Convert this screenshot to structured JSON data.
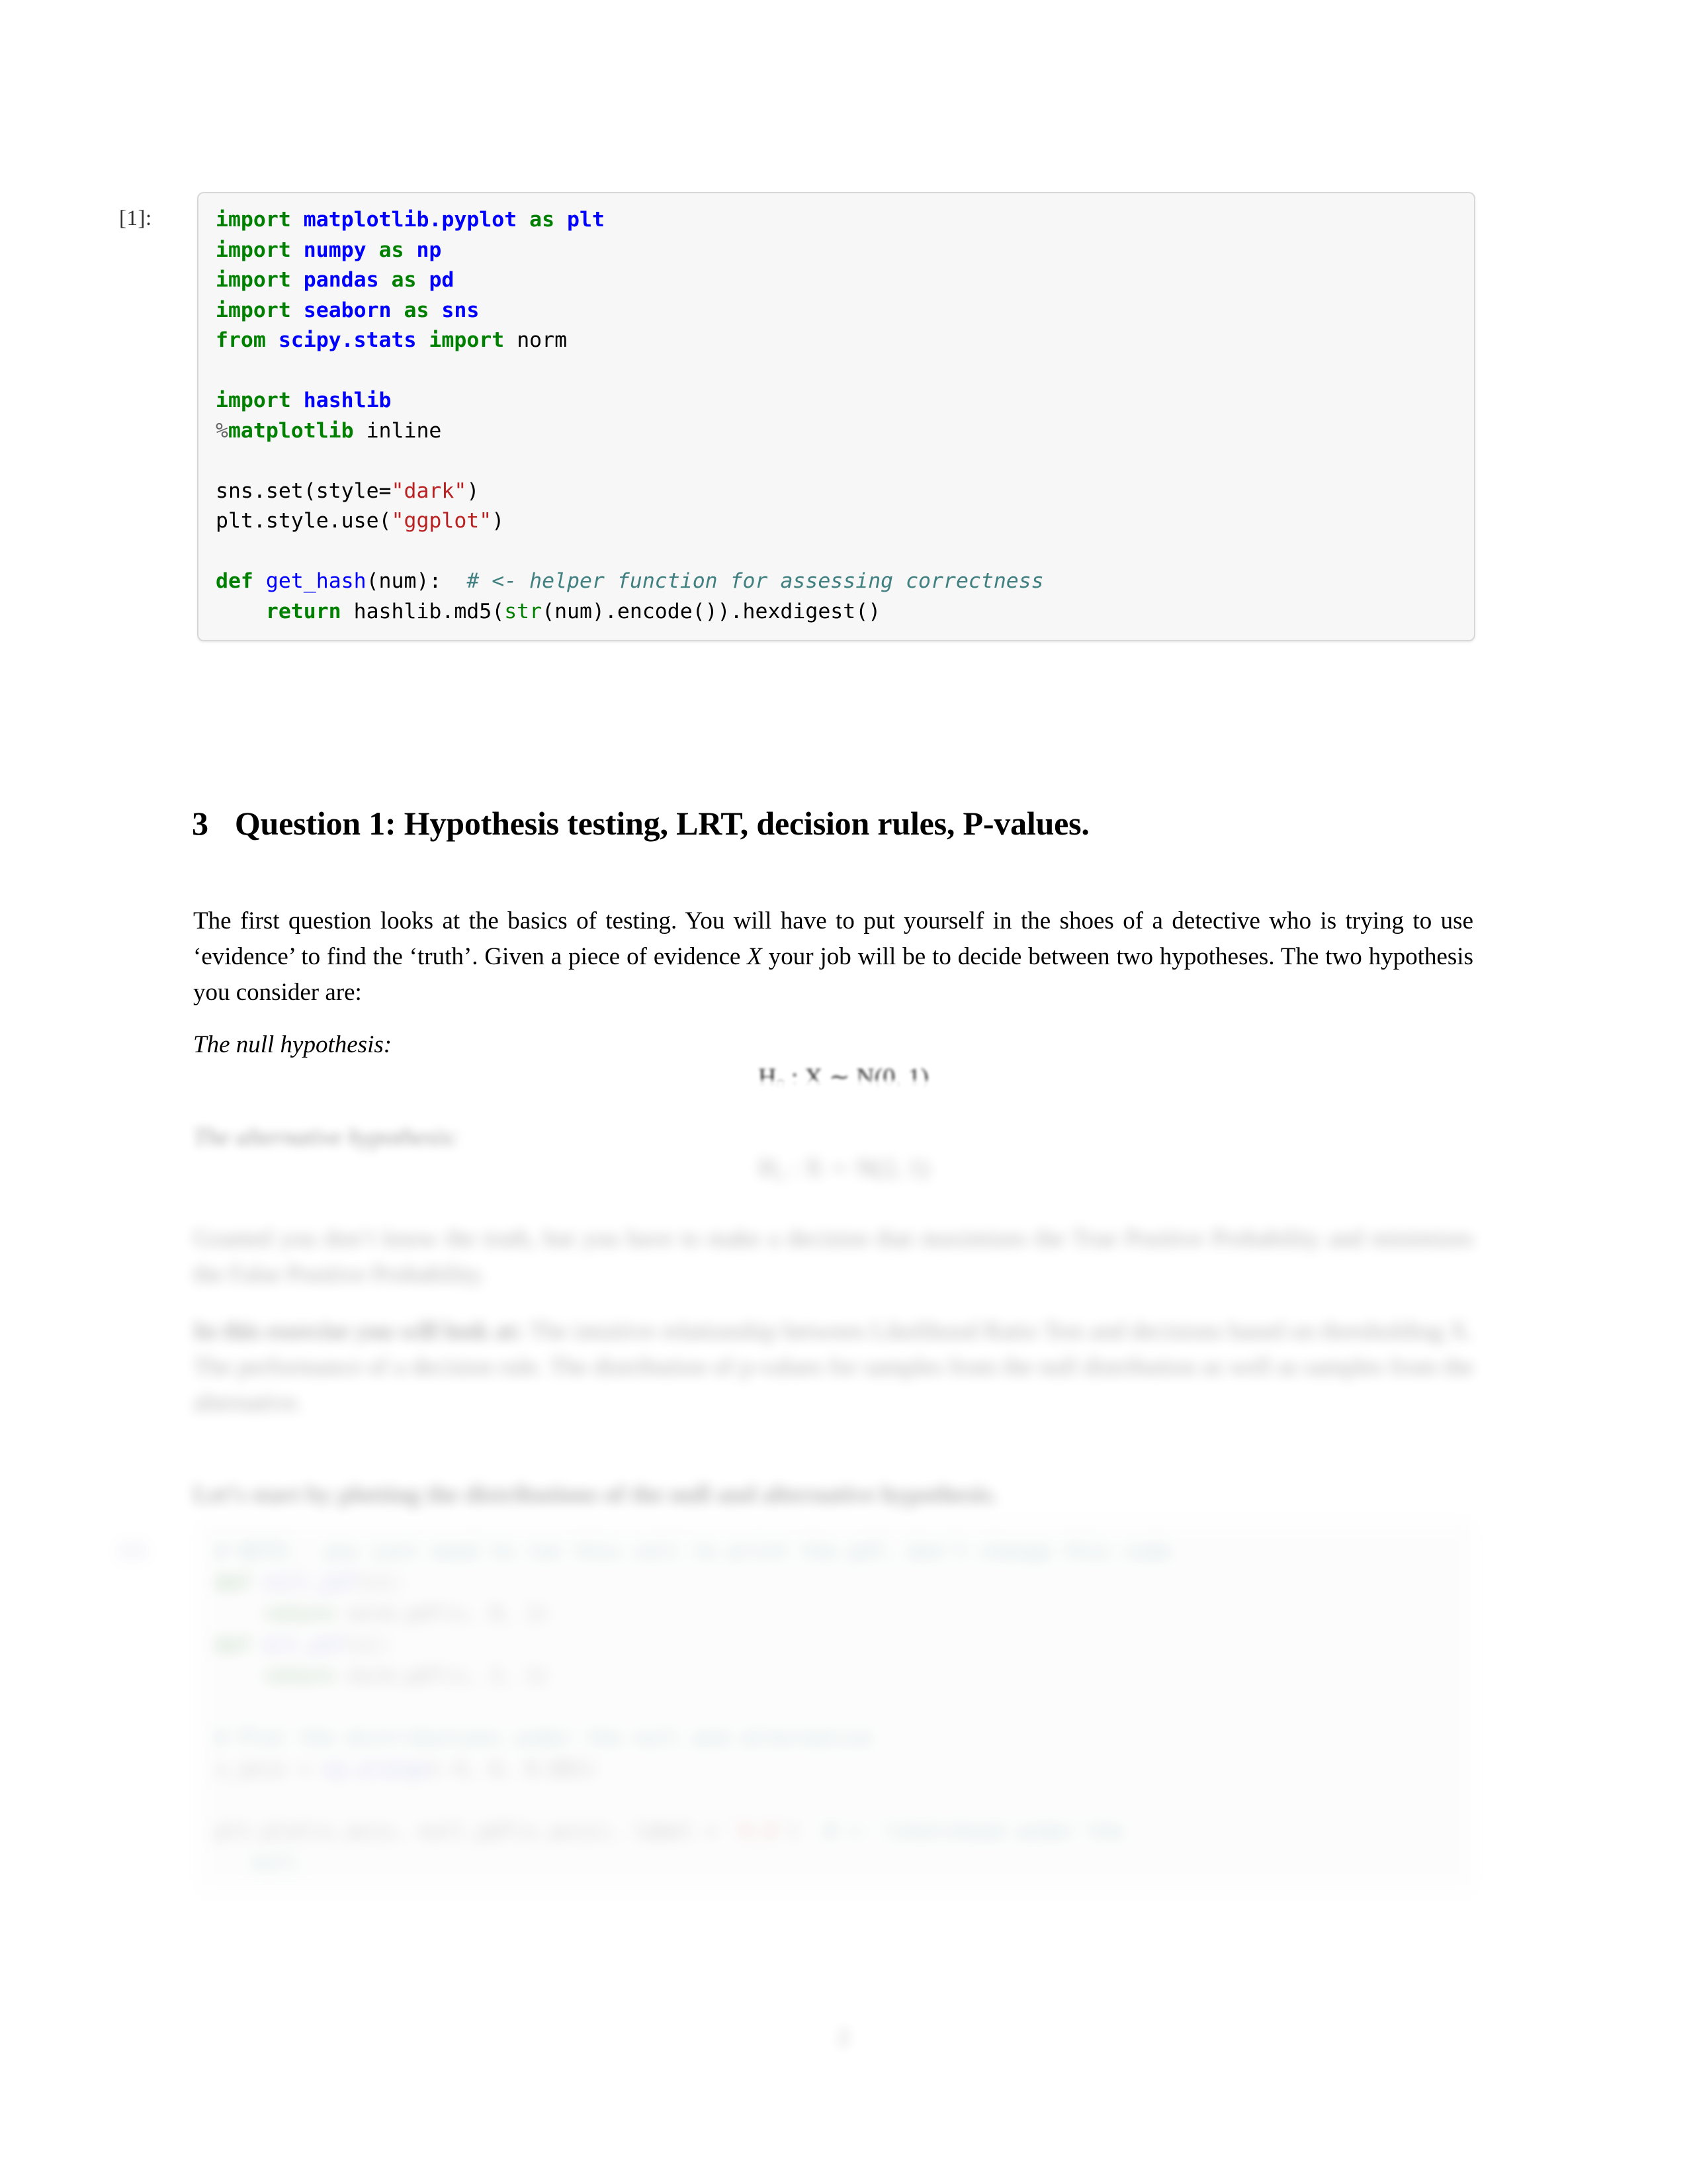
{
  "document": {
    "kind": "jupyter-notebook-pdf",
    "page_number": "2"
  },
  "code_cell_1": {
    "prompt": "[1]:",
    "lines": [
      {
        "id": "l1",
        "text": "import matplotlib.pyplot as plt"
      },
      {
        "id": "l2",
        "text": "import numpy as np"
      },
      {
        "id": "l3",
        "text": "import pandas as pd"
      },
      {
        "id": "l4",
        "text": "import seaborn as sns"
      },
      {
        "id": "l5",
        "text": "from scipy.stats import norm"
      },
      {
        "id": "l6",
        "text": ""
      },
      {
        "id": "l7",
        "text": "import hashlib"
      },
      {
        "id": "l8",
        "text": "%matplotlib inline"
      },
      {
        "id": "l9",
        "text": ""
      },
      {
        "id": "l10",
        "text": "sns.set(style=\"dark\")"
      },
      {
        "id": "l11",
        "text": "plt.style.use(\"ggplot\")"
      },
      {
        "id": "l12",
        "text": ""
      },
      {
        "id": "l13",
        "text": "def get_hash(num):  # <- helper function for assessing correctness"
      },
      {
        "id": "l14",
        "text": "    return hashlib.md5(str(num).encode()).hexdigest()"
      }
    ],
    "tokens": {
      "import": "import",
      "from": "from",
      "def": "def",
      "return": "return",
      "matplotlib_pyplot": "matplotlib.pyplot",
      "as": "as",
      "plt": "plt",
      "numpy": "numpy",
      "np": "np",
      "pandas": "pandas",
      "pd": "pd",
      "seaborn": "seaborn",
      "sns": "sns",
      "scipy_stats": "scipy.stats",
      "norm": "norm",
      "hashlib": "hashlib",
      "magic": "matplotlib",
      "magic_arg": "inline",
      "sns_set": "sns.set(style=",
      "dark": "\"dark\"",
      "close_paren": ")",
      "plt_style": "plt.style.use(",
      "ggplot": "\"ggplot\"",
      "get_hash": "get_hash",
      "num_args": "(num):",
      "comment": "# <- helper function for assessing correctness",
      "return_body_a": "hashlib.md5(",
      "str_builtin": "str",
      "return_body_b": "(num).encode()).hexdigest()"
    }
  },
  "section": {
    "number": "3",
    "title": "Question 1: Hypothesis testing, LRT, decision rules, P-values."
  },
  "intro_paragraph": {
    "part1": "The first question looks at the basics of testing. You will have to put yourself in the shoes of a detective who is trying to use ‘evidence’ to find the ‘truth’. Given a piece of evidence ",
    "math_X": "X",
    "part2": " your job will be to decide between two hypotheses. The two hypothesis you consider are:"
  },
  "null_hypothesis": {
    "label": "The null hypothesis:",
    "equation_H": "H",
    "equation_sub": "0",
    "equation_rest": " : X ∼ N(0, 1)"
  },
  "alternative_hypothesis": {
    "label": "The alternative hypothesis:",
    "equation_H": "H",
    "equation_sub": "1",
    "equation_rest": " : X ∼ N(2, 1)"
  },
  "body_paragraph_2": {
    "text": "Granted you don’t know the truth, but you have to make a decision that maximizes the True Positive Probability and minimizes the False Positive Probability."
  },
  "body_paragraph_3": {
    "lead": "In this exercise you will look at:",
    "rest": "The intuitive relationship between Likelihood Ratio Test and decisions based on thresholding X. The performance of a decision rule. The distribution of p-values for samples from the null distribution as well as samples from the alternative."
  },
  "body_paragraph_4": {
    "text": "Let’s start by plotting the distributions of the null and alternative hypothesis."
  },
  "code_cell_2": {
    "prompt": "[2]:",
    "lines": [
      {
        "id": "m1",
        "text": "# NOTE:  you just need to run this cell to print the pdf, don't change this code"
      },
      {
        "id": "m2",
        "text": "def null_pdf(x):"
      },
      {
        "id": "m3",
        "text": "    return norm.pdf(x, 0, 1)"
      },
      {
        "id": "m4",
        "text": "def alt_pdf(x):"
      },
      {
        "id": "m5",
        "text": "    return norm.pdf(x, 2, 1)"
      },
      {
        "id": "m6",
        "text": ""
      },
      {
        "id": "m7",
        "text": "# Plot the distributions under the null and alternative"
      },
      {
        "id": "m8",
        "text": "x_axis = np.arange(-4, 6, 0.001)"
      },
      {
        "id": "m9",
        "text": ""
      },
      {
        "id": "m10",
        "text": "plt.plot(x_axis, null_pdf(x_axis), label = 'H_0')  # <- likelihood under the"
      },
      {
        "id": "m11",
        "text": "   null"
      }
    ]
  }
}
